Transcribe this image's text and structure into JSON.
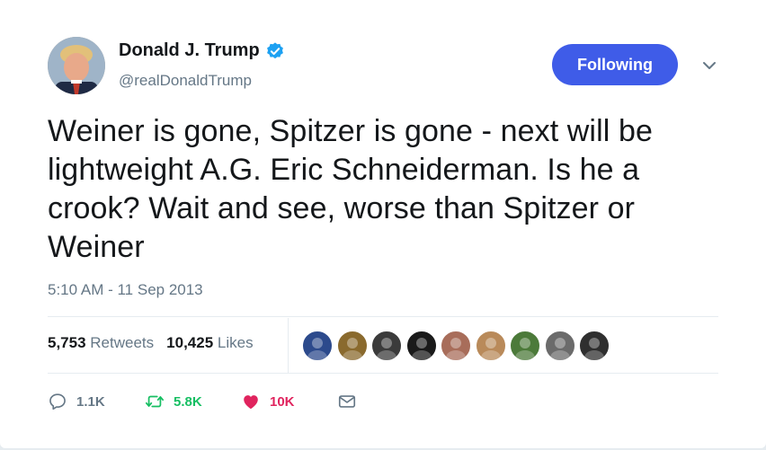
{
  "author": {
    "name": "Donald J. Trump",
    "handle": "@realDonaldTrump",
    "verified": true
  },
  "follow_button": {
    "label": "Following",
    "color": "#3f5ce8"
  },
  "tweet": {
    "text": "Weiner is gone, Spitzer is gone - next will be lightweight A.G. Eric Schneiderman. Is he a crook? Wait and see, worse than Spitzer or Weiner",
    "timestamp": "5:10 AM - 11 Sep 2013"
  },
  "stats": {
    "retweets_count": "5,753",
    "retweets_label": "Retweets",
    "likes_count": "10,425",
    "likes_label": "Likes"
  },
  "likers": [
    {
      "icon": "seal-avatar",
      "color": "#2c4a8c"
    },
    {
      "icon": "watch-avatar",
      "color": "#8a6a2e"
    },
    {
      "icon": "person-avatar",
      "color": "#3b3b3b"
    },
    {
      "icon": "text-logo-avatar",
      "color": "#1a1a1a"
    },
    {
      "icon": "person-avatar",
      "color": "#a86d5a"
    },
    {
      "icon": "person-avatar",
      "color": "#b98a5a"
    },
    {
      "icon": "golf-avatar",
      "color": "#4c7a3a"
    },
    {
      "icon": "statue-avatar",
      "color": "#6b6b6b"
    },
    {
      "icon": "person-avatar",
      "color": "#2f2f2f"
    }
  ],
  "actions": {
    "reply_count": "1.1K",
    "retweet_count": "5.8K",
    "like_count": "10K",
    "reply_color": "#657786",
    "retweet_color": "#17bf63",
    "like_color": "#e0245e"
  }
}
